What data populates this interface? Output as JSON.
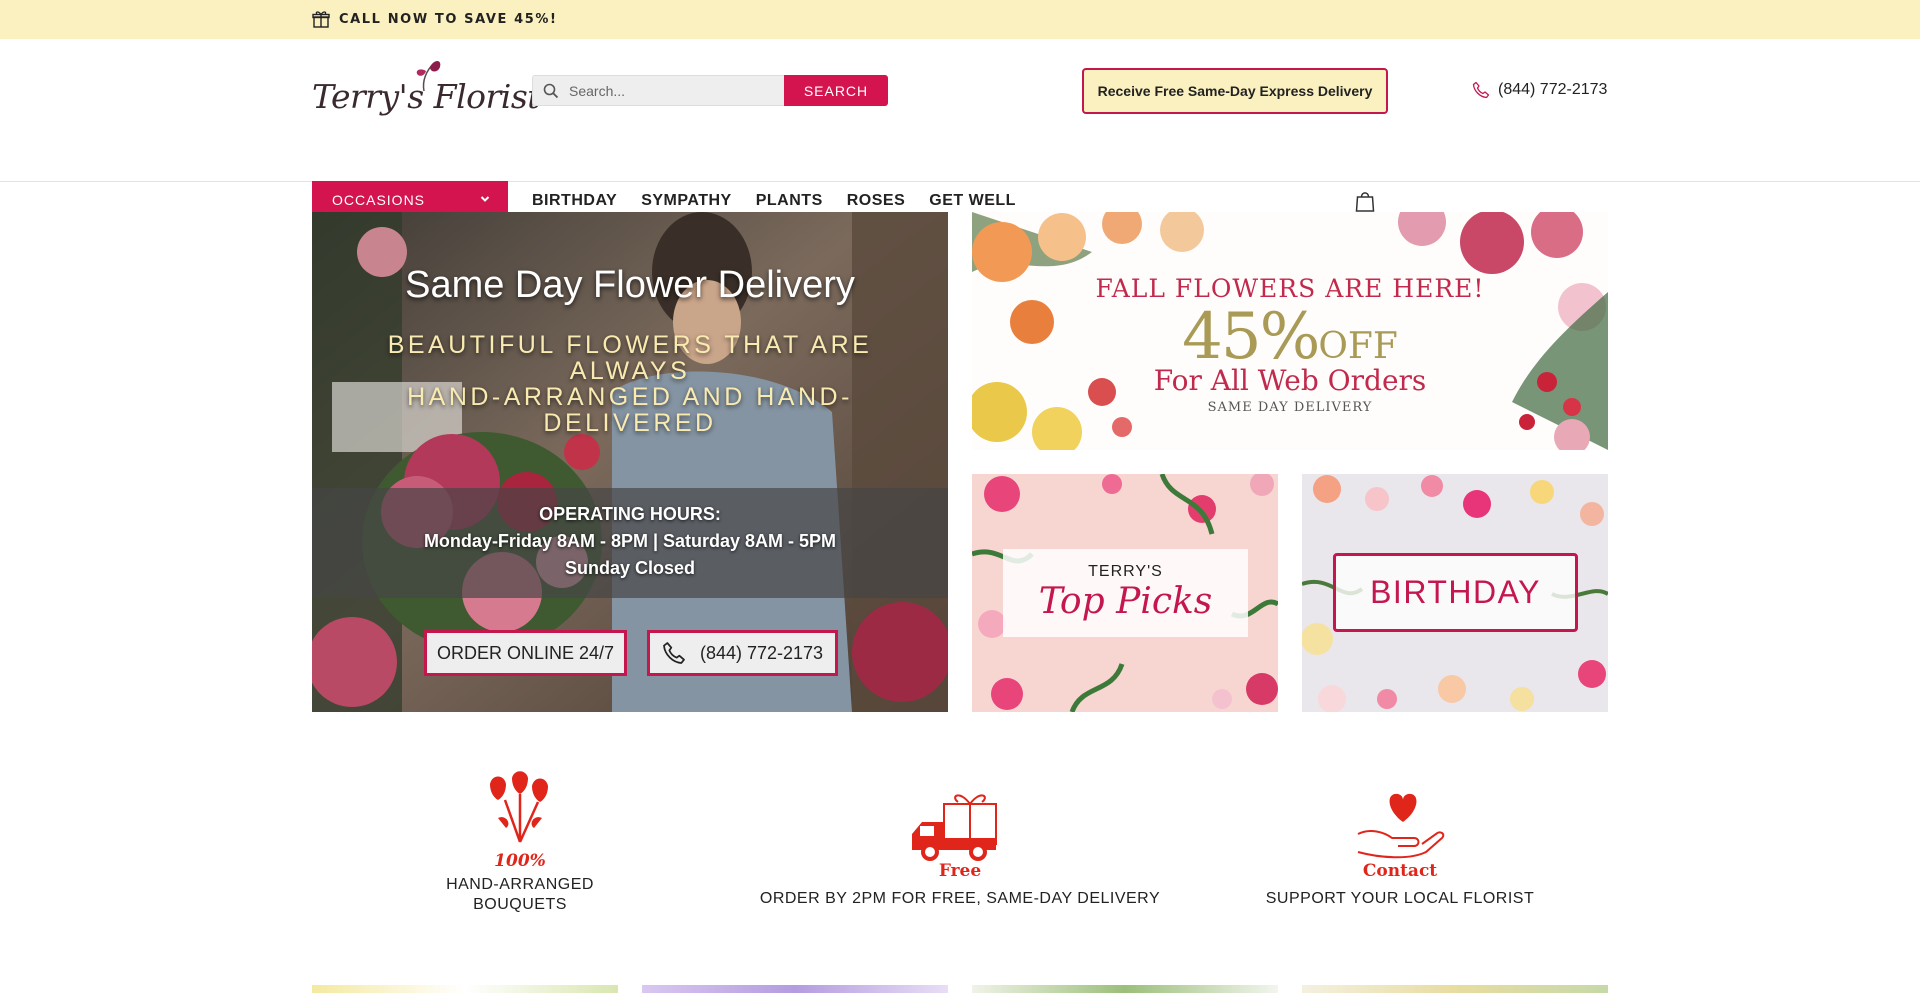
{
  "topbar": {
    "promo_text": "CALL NOW TO SAVE 45%!"
  },
  "header": {
    "logo_text": "Terry's Florist",
    "search": {
      "placeholder": "Search...",
      "button_label": "SEARCH"
    },
    "express_label": "Receive Free Same-Day Express Delivery",
    "phone": "(844) 772-2173"
  },
  "nav": {
    "occasions_label": "OCCASIONS",
    "links": [
      "BIRTHDAY",
      "SYMPATHY",
      "PLANTS",
      "ROSES",
      "GET WELL"
    ]
  },
  "hero": {
    "title": "Same Day Flower Delivery",
    "subtitle_line1": "BEAUTIFUL FLOWERS THAT ARE ALWAYS",
    "subtitle_line2": "HAND-ARRANGED AND HAND-DELIVERED",
    "hours_title": "OPERATING HOURS:",
    "hours_line1": "Monday-Friday 8AM - 8PM | Saturday 8AM - 5PM",
    "hours_line2": "Sunday Closed",
    "order_button": "ORDER ONLINE 24/7",
    "phone_button": "(844) 772-2173"
  },
  "promo": {
    "line1": "FALL FLOWERS ARE HERE!",
    "percent": "45%",
    "off": "OFF",
    "line3": "For All Web Orders",
    "line4": "SAME DAY DELIVERY"
  },
  "tiles": {
    "top_picks_small": "TERRY'S",
    "top_picks_script": "Top Picks",
    "birthday": "BIRTHDAY"
  },
  "features": [
    {
      "icon_text": "100%",
      "label_line1": "HAND-ARRANGED",
      "label_line2": "BOUQUETS"
    },
    {
      "icon_text": "Free",
      "label": "ORDER BY 2PM FOR FREE, SAME-DAY DELIVERY"
    },
    {
      "icon_text": "Contact",
      "label": "SUPPORT YOUR LOCAL FLORIST"
    }
  ],
  "colors": {
    "brand": "#d3144f",
    "promo_bg": "#fbf1c0",
    "feature_red": "#e0251b"
  }
}
